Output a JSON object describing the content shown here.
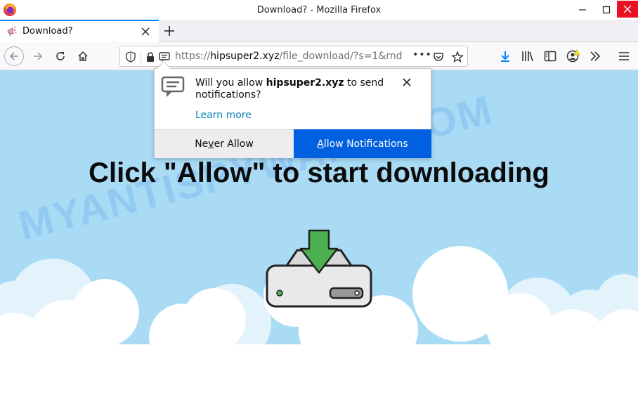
{
  "window": {
    "title": "Download? - Mozilla Firefox"
  },
  "tabs": [
    {
      "label": "Download?"
    }
  ],
  "urlbar": {
    "scheme": "https://",
    "host": "hipsuper2.xyz",
    "path": "/file_download/?s=1&rnd",
    "more_label": "•••"
  },
  "popup": {
    "message_prefix": "Will you allow ",
    "site": "hipsuper2.xyz",
    "message_suffix": " to send notifications?",
    "learn_more": "Learn more",
    "never_pre": "Ne",
    "never_accel": "v",
    "never_post": "er Allow",
    "allow_accel": "A",
    "allow_post": "llow Notifications"
  },
  "page": {
    "headline": "Click \"Allow\" to start downloading",
    "watermark": "MYANTISPYWARE.COM"
  },
  "colors": {
    "sky": "#a9dbf5",
    "accent": "#0060df",
    "download_arrow": "#4caf50",
    "close_button": "#e81123"
  },
  "icons": {
    "tab": "megaphone-icon",
    "toolbar": [
      "back-icon",
      "forward-icon",
      "reload-icon",
      "home-icon",
      "shield-icon",
      "lock-icon",
      "notification-icon",
      "pocket-icon",
      "star-icon",
      "download-icon",
      "library-icon",
      "sidebar-icon",
      "account-icon",
      "overflow-icon",
      "menu-icon"
    ]
  }
}
